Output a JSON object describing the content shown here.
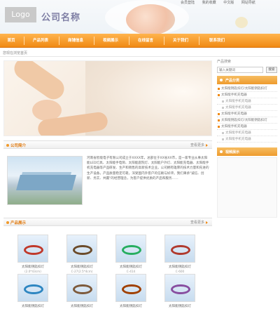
{
  "header": {
    "logo_text": "Logo",
    "company_name": "公司名称",
    "top_links": [
      "会员登陆",
      "我的收藏",
      "中文版",
      "网站导航"
    ]
  },
  "nav": {
    "items": [
      "首页",
      "产品列表",
      "商铺信息",
      "视频展示",
      "在线留言",
      "关于我们",
      "联系我们"
    ]
  },
  "breadcrumb": "您现在浏览首页",
  "company_intro": {
    "title": "公司简介",
    "more": "查看更多",
    "text": "河南省智能电子有限公司成立于XXXX年，总部位于XX省XX市，是一家专业从事太阳能LED灯具、太阳能手电筒、太阳能庭院灯、太阳能户外灯、太阳能充电器、太阳能手机充电器等产品研发、生产和销售的高新技术企业。公司拥有雄厚的技术力量和先进的生产设备，产品质量稳定可靠，深受国内外客户的信赖与好评。我们秉承\"诚信、创新、务实、共赢\"的经营理念，为客户提供优质的产品和服务……"
  },
  "products": {
    "title": "产品展示",
    "more": "查看更多",
    "items": [
      {
        "name": "太阳能钥匙扣灯",
        "code": "(2.0*43cm)",
        "color": "#c0392b"
      },
      {
        "name": "太阳能钥匙扣灯",
        "code": "C-27(2.5*4cm)",
        "color": "#6b4b2a"
      },
      {
        "name": "太阳能钥匙扣灯",
        "code": "C-414",
        "color": "#27ae60"
      },
      {
        "name": "太阳能钥匙扣灯",
        "code": "C-600",
        "color": "#b03a2e"
      },
      {
        "name": "太阳能钥匙扣灯",
        "code": "",
        "color": "#2e86c1"
      },
      {
        "name": "太阳能钥匙扣灯",
        "code": "",
        "color": "#7d5a3c"
      },
      {
        "name": "太阳能钥匙扣灯",
        "code": "",
        "color": "#a04000"
      },
      {
        "name": "太阳能钥匙扣灯",
        "code": "",
        "color": "#884ea0"
      }
    ]
  },
  "sidebar": {
    "search_title": "产品搜索",
    "search_placeholder": "输入关键词",
    "search_button": "搜索",
    "category_title": "产品分类",
    "categories": [
      {
        "label": "太阳能钥匙扣灯/太阳能钥匙扣灯",
        "sub": false
      },
      {
        "label": "太阳能手机充电器",
        "sub": false
      },
      {
        "label": "太阳能手机充电器",
        "sub": true
      },
      {
        "label": "太阳能手机充电器",
        "sub": true
      },
      {
        "label": "太阳能手机充电器",
        "sub": false
      },
      {
        "label": "太阳能钥匙扣灯/太阳能钥匙扣灯",
        "sub": false
      },
      {
        "label": "太阳能手机充电器",
        "sub": false
      },
      {
        "label": "太阳能手机充电器",
        "sub": true
      },
      {
        "label": "太阳能手机充电器",
        "sub": true
      }
    ],
    "video_title": "视频展示"
  },
  "colors": {
    "accent": "#f08a14",
    "nav_top": "#ffb44d"
  }
}
